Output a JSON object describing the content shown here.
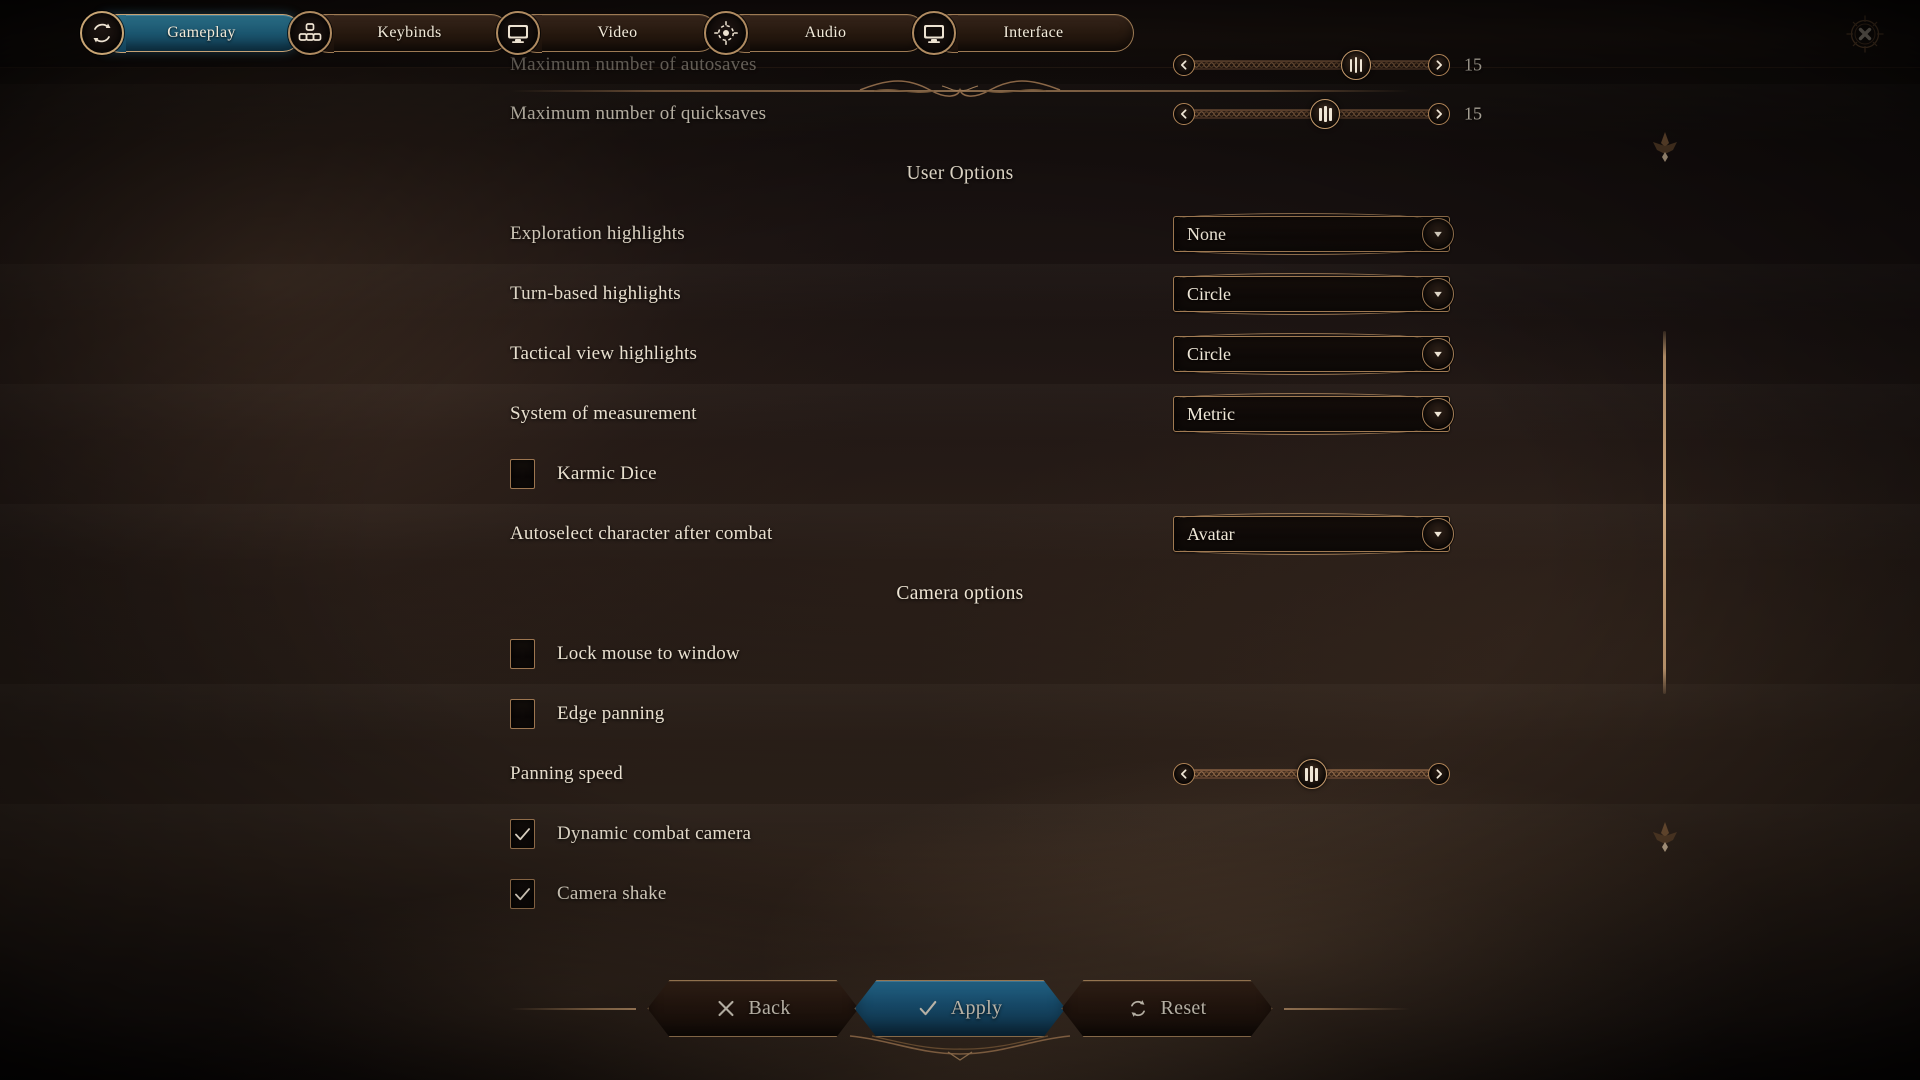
{
  "window": {
    "close_icon": "close-x-icon"
  },
  "tabs": [
    {
      "label": "Gameplay",
      "icon": "gameplay-dice-icon",
      "active": true
    },
    {
      "label": "Keybinds",
      "icon": "keybinds-keys-icon",
      "active": false
    },
    {
      "label": "Video",
      "icon": "video-monitor-icon",
      "active": false
    },
    {
      "label": "Audio",
      "icon": "audio-speaker-icon",
      "active": false
    },
    {
      "label": "Interface",
      "icon": "interface-monitor-icon",
      "active": false
    }
  ],
  "rows": [
    {
      "type": "slider",
      "label": "Maximum number of autosaves",
      "value": "15",
      "position": 66,
      "clipped": true
    },
    {
      "type": "slider",
      "label": "Maximum number of quicksaves",
      "value": "15",
      "position": 55
    },
    {
      "type": "section",
      "label": "User Options"
    },
    {
      "type": "dropdown",
      "label": "Exploration highlights",
      "value": "None"
    },
    {
      "type": "dropdown",
      "label": "Turn-based highlights",
      "value": "Circle"
    },
    {
      "type": "dropdown",
      "label": "Tactical view highlights",
      "value": "Circle"
    },
    {
      "type": "dropdown",
      "label": "System of measurement",
      "value": "Metric"
    },
    {
      "type": "checkbox",
      "label": "Karmic Dice",
      "checked": false
    },
    {
      "type": "dropdown",
      "label": "Autoselect character after combat",
      "value": "Avatar"
    },
    {
      "type": "section",
      "label": "Camera options"
    },
    {
      "type": "checkbox",
      "label": "Lock mouse to window",
      "checked": false
    },
    {
      "type": "checkbox",
      "label": "Edge panning",
      "checked": false
    },
    {
      "type": "slider",
      "label": "Panning speed",
      "value": "",
      "position": 50
    },
    {
      "type": "checkbox",
      "label": "Dynamic combat camera",
      "checked": true
    },
    {
      "type": "checkbox",
      "label": "Camera shake",
      "checked": true
    }
  ],
  "buttons": [
    {
      "label": "Back",
      "icon": "close-x-icon",
      "primary": false
    },
    {
      "label": "Apply",
      "icon": "checkmark-icon",
      "primary": true
    },
    {
      "label": "Reset",
      "icon": "refresh-icon",
      "primary": false
    }
  ],
  "colors": {
    "accent_gold": "#b08b61",
    "accent_blue": "#1d5f87",
    "text": "#e9e0cf",
    "scrollbar": "#e0b688"
  }
}
